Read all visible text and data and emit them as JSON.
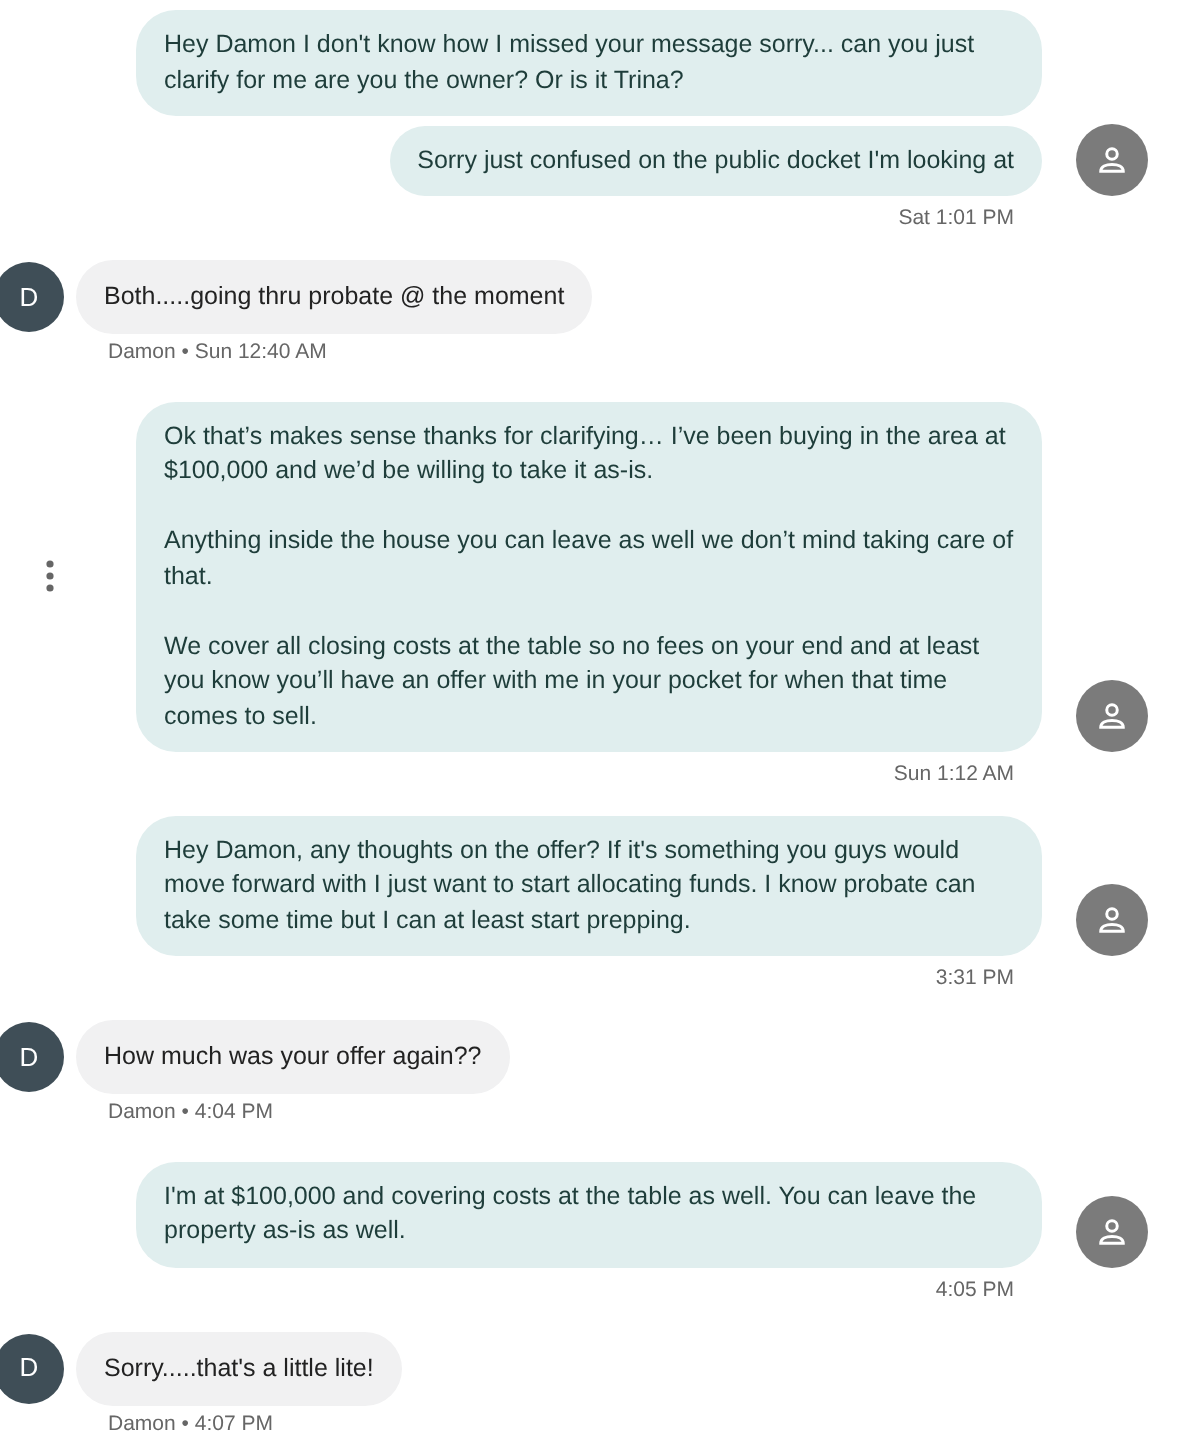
{
  "messages": [
    {
      "kind": "outgoing",
      "bubbles": [
        {
          "paragraphs": [
            "Hey Damon I don't know how I missed your message sorry... can you just clarify for me are you the owner? Or is it Trina?"
          ]
        },
        {
          "paragraphs": [
            "Sorry just confused on the public docket I'm looking at"
          ]
        }
      ],
      "menu": false,
      "time": "Sat 1:01 PM"
    },
    {
      "kind": "incoming",
      "avatar": "D",
      "text": "Both.....going thru probate @ the moment",
      "meta": "Damon • Sun 12:40 AM"
    },
    {
      "kind": "outgoing",
      "bubbles": [
        {
          "paragraphs": [
            "Ok that’s makes sense thanks for clarifying… I’ve been buying in the area at $100,000 and we’d be willing to take it as-is.",
            "Anything inside the house you can leave as well we don’t mind taking care of that.",
            "We cover all closing costs at the table so no fees on your end and at least you know you’ll have an offer with me in your pocket for when that time comes to sell."
          ]
        }
      ],
      "menu": true,
      "time": "Sun 1:12 AM"
    },
    {
      "kind": "outgoing",
      "bubbles": [
        {
          "paragraphs": [
            "Hey Damon, any thoughts on the offer? If it's something you guys would move forward with I just want to start allocating funds. I know probate can take some time but I can at least start prepping."
          ]
        }
      ],
      "menu": false,
      "time": "3:31 PM"
    },
    {
      "kind": "incoming",
      "avatar": "D",
      "text": "How much was your offer again??",
      "meta": "Damon • 4:04 PM"
    },
    {
      "kind": "outgoing",
      "bubbles": [
        {
          "paragraphs": [
            "I'm at $100,000 and covering costs at the table as well. You can leave the property as-is as well."
          ]
        }
      ],
      "menu": false,
      "time": "4:05 PM"
    },
    {
      "kind": "incoming",
      "avatar": "D",
      "text": "Sorry.....that's a little lite!",
      "meta": "Damon • 4:07 PM"
    }
  ]
}
